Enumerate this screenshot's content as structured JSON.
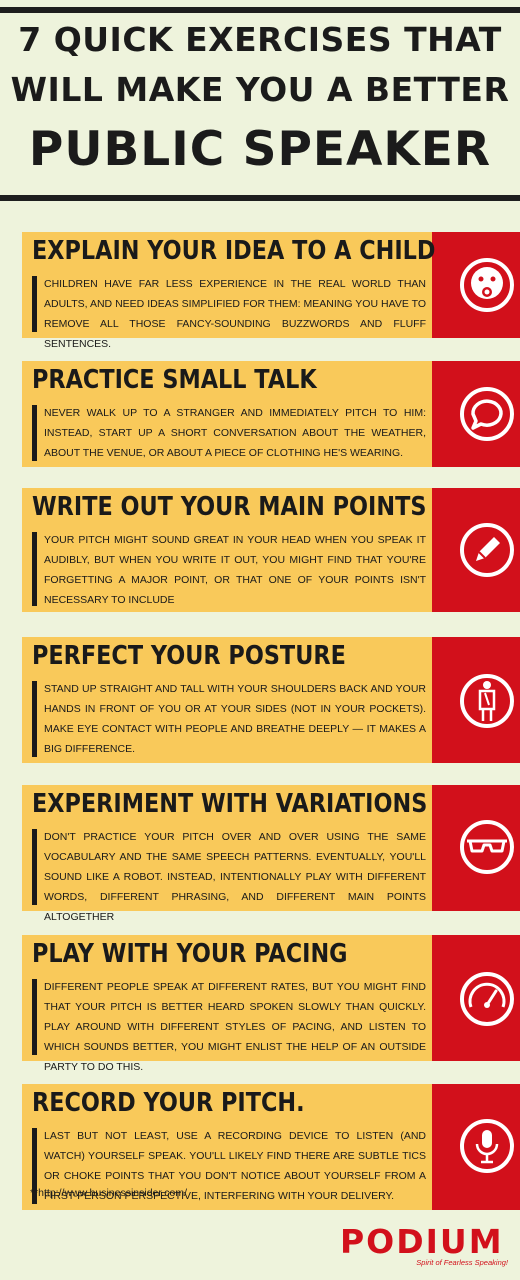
{
  "header": {
    "line1": "7 QUICK EXERCISES THAT",
    "line2": "WILL MAKE YOU A BETTER",
    "line3": "PUBLIC SPEAKER"
  },
  "colors": {
    "background": "#eef3dc",
    "card": "#f9c95a",
    "accent": "#d2101b",
    "text": "#1a1a1a"
  },
  "cards": [
    {
      "heading": "EXPLAIN YOUR IDEA TO A CHILD",
      "body": "Children have far less experience in the real world than adults, and need ideas simplified for them: meaning you have to remove all those fancy-sounding buzzwords and fluff sentences.",
      "icon": "baby-face-icon"
    },
    {
      "heading": "PRACTICE SMALL TALK",
      "body": "Never walk up to a stranger and immediately pitch to him: instead, start up a short conversation about the weather, about the venue, or about a piece of clothing he's wearing.",
      "icon": "speech-bubble-icon"
    },
    {
      "heading": "WRITE OUT YOUR MAIN POINTS",
      "body": "Your pitch might sound great in your head when you speak it audibly, but when you write it out, you might find that you're forgetting a major point, or that one of your points isn't necessary to include",
      "icon": "pencil-icon"
    },
    {
      "heading": "PERFECT YOUR POSTURE",
      "body": "Stand up straight and tall with your shoulders back and your hands in front of you or at your sides (not in your pockets). Make eye contact with people and breathe deeply — it makes a big difference.",
      "icon": "standing-person-icon"
    },
    {
      "heading": "EXPERIMENT WITH VARIATIONS",
      "body": "Don't practice your pitch over and over using the same vocabulary and the same speech patterns. Eventually, you'll sound like a robot. Instead, intentionally play with different words, different phrasing, and different main points altogether",
      "icon": "glasses-icon"
    },
    {
      "heading": "PLAY WITH YOUR PACING",
      "body": "Different people speak at different rates, but you might find that your pitch is better heard spoken slowly than quickly. Play around with different styles of pacing, and listen to which sounds better, you might enlist the help of an outside party to do this.",
      "icon": "speedometer-icon"
    },
    {
      "heading": "RECORD YOUR PITCH.",
      "body": "Last but not least, use a recording device to listen (and watch) yourself speak. You'll likely find there are subtle tics or choke points that you don't notice about yourself from a first-person perspective, interfering with your delivery.",
      "icon": "microphone-icon"
    }
  ],
  "footer": {
    "source": "**http://www.businessinsider.com/",
    "logo_word": "PODIUM",
    "logo_tagline": "Spirit of Fearless Speaking!"
  }
}
